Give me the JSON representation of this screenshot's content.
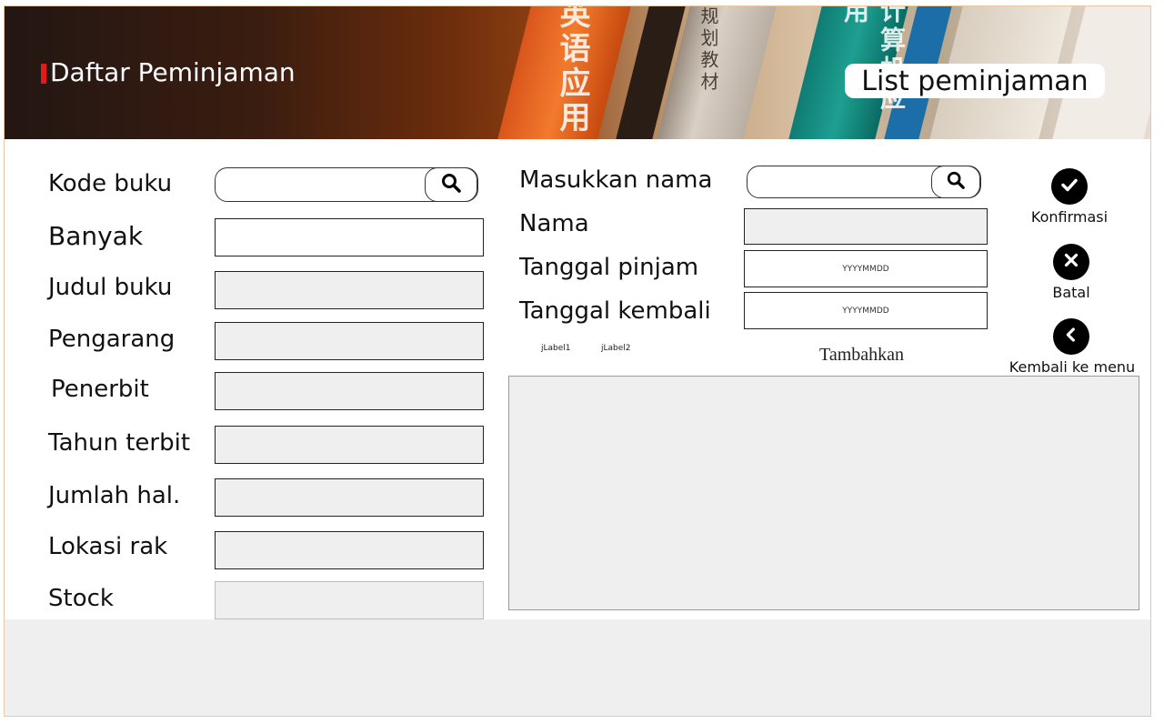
{
  "header": {
    "app_title": "Daftar Peminjaman",
    "list_button": "List peminjaman",
    "spine_texts": [
      "英语应用",
      "规划教材",
      "计算机应用"
    ]
  },
  "book_form": {
    "kode_buku": "Kode buku",
    "banyak": "Banyak",
    "judul_buku": "Judul buku",
    "pengarang": "Pengarang",
    "penerbit": "Penerbit",
    "tahun_terbit": "Tahun terbit",
    "jumlah_hal": "Jumlah hal.",
    "lokasi_rak": "Lokasi rak",
    "stock": "Stock"
  },
  "borrower_form": {
    "masukkan_nama": "Masukkan nama",
    "nama": "Nama",
    "tanggal_pinjam": "Tanggal pinjam",
    "tanggal_kembali": "Tanggal kembali",
    "date_placeholder": "YYYYMMDD",
    "jlabel1": "jLabel1",
    "jlabel2": "jLabel2",
    "tambahkan": "Tambahkan"
  },
  "actions": {
    "konfirmasi": "Konfirmasi",
    "batal": "Batal",
    "kembali": "Kembali ke menu"
  },
  "icons": {
    "search": "search-icon",
    "confirm": "check-icon",
    "cancel": "close-icon",
    "back": "chevron-left-icon"
  },
  "colors": {
    "brand_accent": "#e31b1b",
    "field_bg": "#efefef"
  }
}
